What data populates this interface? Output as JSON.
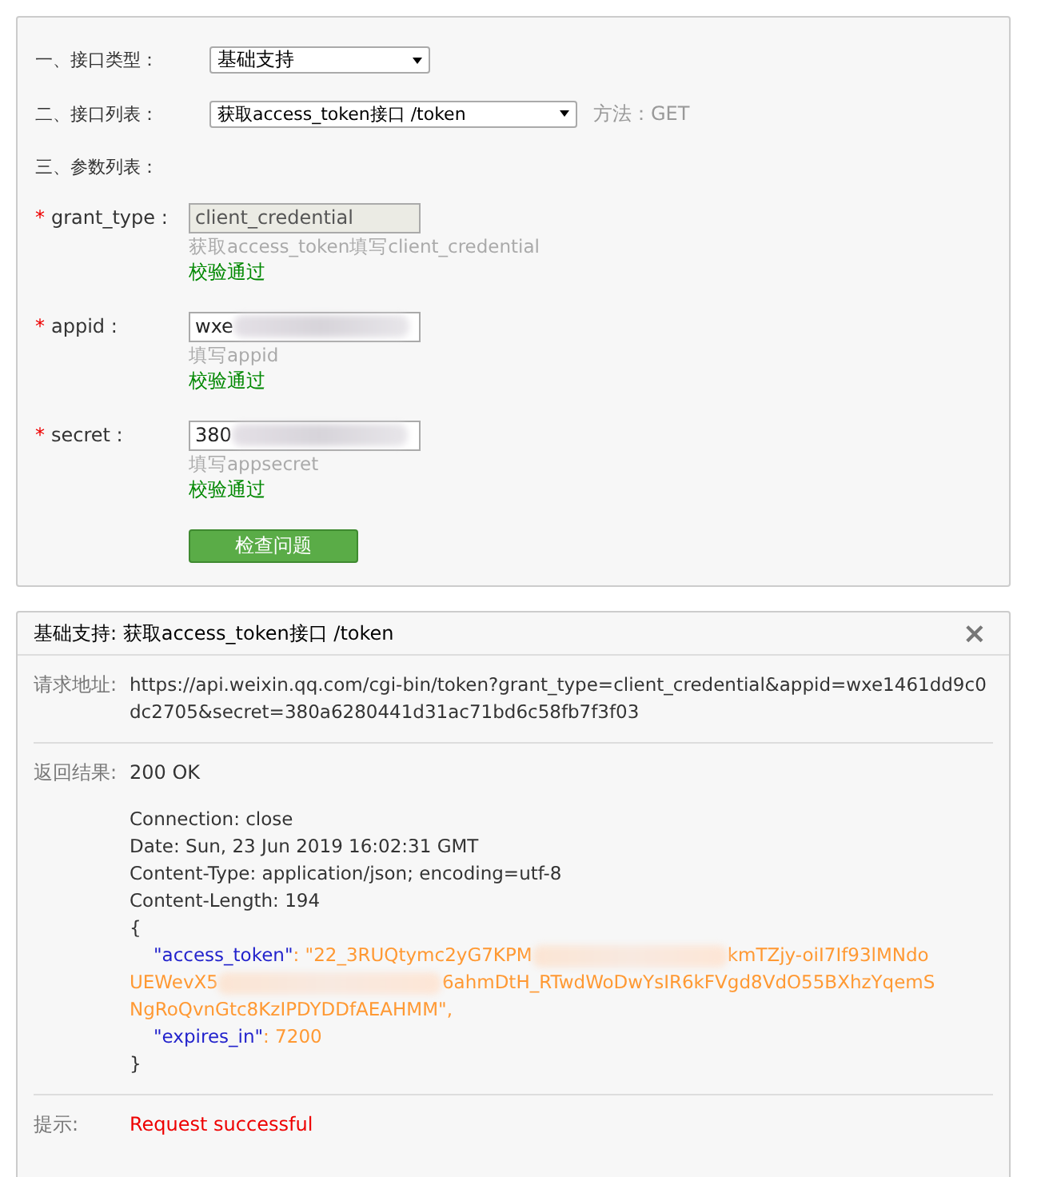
{
  "form": {
    "type_label": "一、接口类型：",
    "type_value": "基础支持",
    "list_label": "二、接口列表：",
    "list_value": "获取access_token接口 /token",
    "method": "方法：GET",
    "params_label": "三、参数列表：",
    "params": [
      {
        "mark": "*",
        "label": "grant_type :",
        "value": "client_credential",
        "disabled": true,
        "hint": "获取access_token填写client_credential",
        "status": "校验通过"
      },
      {
        "mark": "*",
        "label": "appid :",
        "value": "wxe",
        "disabled": false,
        "redacted": true,
        "hint": "填写appid",
        "status": "校验通过"
      },
      {
        "mark": "*",
        "label": "secret :",
        "value": "380",
        "disabled": false,
        "redacted": true,
        "hint": "填写appsecret",
        "status": "校验通过"
      }
    ],
    "button": "检查问题"
  },
  "result": {
    "title": "基础支持: 获取access_token接口 /token",
    "close": "×",
    "url_label": "请求地址:",
    "url": "https://api.weixin.qq.com/cgi-bin/token?grant_type=client_credential&appid=wxe1461dd9c0dc2705&secret=380a6280441d31ac71bd6c58fb7f3f03",
    "status_label": "返回结果:",
    "status": "200 OK",
    "headers": [
      "Connection: close",
      "Date: Sun, 23 Jun 2019 16:02:31 GMT",
      "Content-Type: application/json; encoding=utf-8",
      "Content-Length: 194"
    ],
    "open_brace": "{",
    "close_brace": "}",
    "token_key": "\"access_token\"",
    "token_lines": [
      {
        "parts": [
          ": \"22_3RUQtymc2yG7KPM",
          "kmTZjy-oiI7If93lMNdo"
        ]
      },
      {
        "parts": [
          "UEWevX5",
          "6ahmDtH_RTwdWoDwYsIR6kFVgd8VdO55BXhzYqemS"
        ]
      },
      {
        "parts": [
          "NgRoQvnGtc8KzIPDYDDfAEAHMM\","
        ]
      }
    ],
    "expires_key": "\"expires_in\"",
    "expires_value": ": 7200",
    "tip_label": "提示:",
    "tip": "Request successful"
  }
}
